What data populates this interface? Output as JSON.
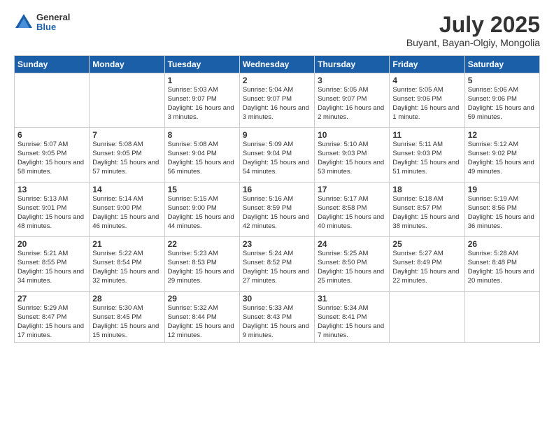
{
  "logo": {
    "general": "General",
    "blue": "Blue"
  },
  "title": "July 2025",
  "subtitle": "Buyant, Bayan-Olgiy, Mongolia",
  "weekdays": [
    "Sunday",
    "Monday",
    "Tuesday",
    "Wednesday",
    "Thursday",
    "Friday",
    "Saturday"
  ],
  "weeks": [
    [
      {
        "day": "",
        "info": ""
      },
      {
        "day": "",
        "info": ""
      },
      {
        "day": "1",
        "info": "Sunrise: 5:03 AM\nSunset: 9:07 PM\nDaylight: 16 hours\nand 3 minutes."
      },
      {
        "day": "2",
        "info": "Sunrise: 5:04 AM\nSunset: 9:07 PM\nDaylight: 16 hours\nand 3 minutes."
      },
      {
        "day": "3",
        "info": "Sunrise: 5:05 AM\nSunset: 9:07 PM\nDaylight: 16 hours\nand 2 minutes."
      },
      {
        "day": "4",
        "info": "Sunrise: 5:05 AM\nSunset: 9:06 PM\nDaylight: 16 hours\nand 1 minute."
      },
      {
        "day": "5",
        "info": "Sunrise: 5:06 AM\nSunset: 9:06 PM\nDaylight: 15 hours\nand 59 minutes."
      }
    ],
    [
      {
        "day": "6",
        "info": "Sunrise: 5:07 AM\nSunset: 9:05 PM\nDaylight: 15 hours\nand 58 minutes."
      },
      {
        "day": "7",
        "info": "Sunrise: 5:08 AM\nSunset: 9:05 PM\nDaylight: 15 hours\nand 57 minutes."
      },
      {
        "day": "8",
        "info": "Sunrise: 5:08 AM\nSunset: 9:04 PM\nDaylight: 15 hours\nand 56 minutes."
      },
      {
        "day": "9",
        "info": "Sunrise: 5:09 AM\nSunset: 9:04 PM\nDaylight: 15 hours\nand 54 minutes."
      },
      {
        "day": "10",
        "info": "Sunrise: 5:10 AM\nSunset: 9:03 PM\nDaylight: 15 hours\nand 53 minutes."
      },
      {
        "day": "11",
        "info": "Sunrise: 5:11 AM\nSunset: 9:03 PM\nDaylight: 15 hours\nand 51 minutes."
      },
      {
        "day": "12",
        "info": "Sunrise: 5:12 AM\nSunset: 9:02 PM\nDaylight: 15 hours\nand 49 minutes."
      }
    ],
    [
      {
        "day": "13",
        "info": "Sunrise: 5:13 AM\nSunset: 9:01 PM\nDaylight: 15 hours\nand 48 minutes."
      },
      {
        "day": "14",
        "info": "Sunrise: 5:14 AM\nSunset: 9:00 PM\nDaylight: 15 hours\nand 46 minutes."
      },
      {
        "day": "15",
        "info": "Sunrise: 5:15 AM\nSunset: 9:00 PM\nDaylight: 15 hours\nand 44 minutes."
      },
      {
        "day": "16",
        "info": "Sunrise: 5:16 AM\nSunset: 8:59 PM\nDaylight: 15 hours\nand 42 minutes."
      },
      {
        "day": "17",
        "info": "Sunrise: 5:17 AM\nSunset: 8:58 PM\nDaylight: 15 hours\nand 40 minutes."
      },
      {
        "day": "18",
        "info": "Sunrise: 5:18 AM\nSunset: 8:57 PM\nDaylight: 15 hours\nand 38 minutes."
      },
      {
        "day": "19",
        "info": "Sunrise: 5:19 AM\nSunset: 8:56 PM\nDaylight: 15 hours\nand 36 minutes."
      }
    ],
    [
      {
        "day": "20",
        "info": "Sunrise: 5:21 AM\nSunset: 8:55 PM\nDaylight: 15 hours\nand 34 minutes."
      },
      {
        "day": "21",
        "info": "Sunrise: 5:22 AM\nSunset: 8:54 PM\nDaylight: 15 hours\nand 32 minutes."
      },
      {
        "day": "22",
        "info": "Sunrise: 5:23 AM\nSunset: 8:53 PM\nDaylight: 15 hours\nand 29 minutes."
      },
      {
        "day": "23",
        "info": "Sunrise: 5:24 AM\nSunset: 8:52 PM\nDaylight: 15 hours\nand 27 minutes."
      },
      {
        "day": "24",
        "info": "Sunrise: 5:25 AM\nSunset: 8:50 PM\nDaylight: 15 hours\nand 25 minutes."
      },
      {
        "day": "25",
        "info": "Sunrise: 5:27 AM\nSunset: 8:49 PM\nDaylight: 15 hours\nand 22 minutes."
      },
      {
        "day": "26",
        "info": "Sunrise: 5:28 AM\nSunset: 8:48 PM\nDaylight: 15 hours\nand 20 minutes."
      }
    ],
    [
      {
        "day": "27",
        "info": "Sunrise: 5:29 AM\nSunset: 8:47 PM\nDaylight: 15 hours\nand 17 minutes."
      },
      {
        "day": "28",
        "info": "Sunrise: 5:30 AM\nSunset: 8:45 PM\nDaylight: 15 hours\nand 15 minutes."
      },
      {
        "day": "29",
        "info": "Sunrise: 5:32 AM\nSunset: 8:44 PM\nDaylight: 15 hours\nand 12 minutes."
      },
      {
        "day": "30",
        "info": "Sunrise: 5:33 AM\nSunset: 8:43 PM\nDaylight: 15 hours\nand 9 minutes."
      },
      {
        "day": "31",
        "info": "Sunrise: 5:34 AM\nSunset: 8:41 PM\nDaylight: 15 hours\nand 7 minutes."
      },
      {
        "day": "",
        "info": ""
      },
      {
        "day": "",
        "info": ""
      }
    ]
  ]
}
